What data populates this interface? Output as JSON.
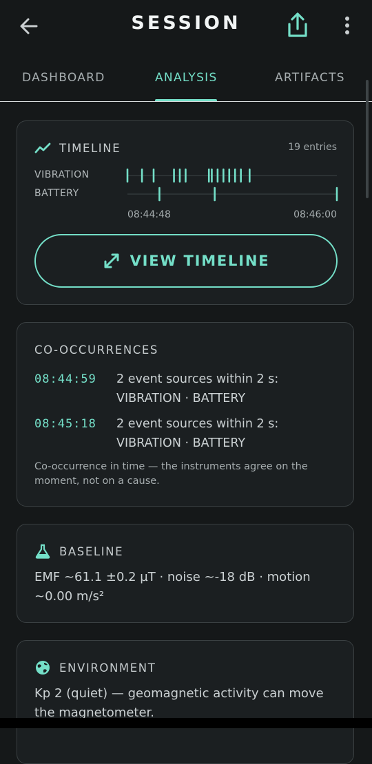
{
  "appbar": {
    "title": "SESSION",
    "back_icon": "arrow-left-icon",
    "share_icon": "share-icon",
    "menu_icon": "more-vertical-icon"
  },
  "tabs": [
    {
      "label": "DASHBOARD",
      "active": false
    },
    {
      "label": "ANALYSIS",
      "active": true
    },
    {
      "label": "ARTIFACTS",
      "active": false
    }
  ],
  "timeline": {
    "title": "TIMELINE",
    "icon": "trend-icon",
    "entries_label": "19 entries",
    "tracks": [
      {
        "label": "VIBRATION",
        "events": [
          "08:44:48",
          "08:44:53",
          "08:44:57",
          "08:45:04",
          "08:45:06",
          "08:45:08",
          "08:45:16",
          "08:45:17",
          "08:45:19",
          "08:45:21",
          "08:45:23",
          "08:45:25",
          "08:45:27",
          "08:45:30"
        ]
      },
      {
        "label": "BATTERY",
        "events": [
          "08:44:59",
          "08:45:18",
          "08:46:00"
        ]
      }
    ],
    "start_label": "08:44:48",
    "end_label": "08:46:00",
    "button_label": "VIEW TIMELINE",
    "button_icon": "expand-icon",
    "accent_color": "#74dfc8"
  },
  "co_occurrences": {
    "title": "CO-OCCURRENCES",
    "items": [
      {
        "time": "08:44:59",
        "line1": "2 event sources within 2 s:",
        "line2": "VIBRATION · BATTERY"
      },
      {
        "time": "08:45:18",
        "line1": "2 event sources within 2 s:",
        "line2": "VIBRATION · BATTERY"
      }
    ],
    "note": "Co-occurrence in time — the instruments agree on the moment, not on a cause."
  },
  "baseline": {
    "title": "BASELINE",
    "icon": "flask-icon",
    "text": "EMF ~61.1 ±0.2 µT · noise ~-18 dB · motion ~0.00 m/s²"
  },
  "environment": {
    "title": "ENVIRONMENT",
    "icon": "globe-icon",
    "text": "Kp 2 (quiet) — geomagnetic activity can move the magnetometer."
  }
}
